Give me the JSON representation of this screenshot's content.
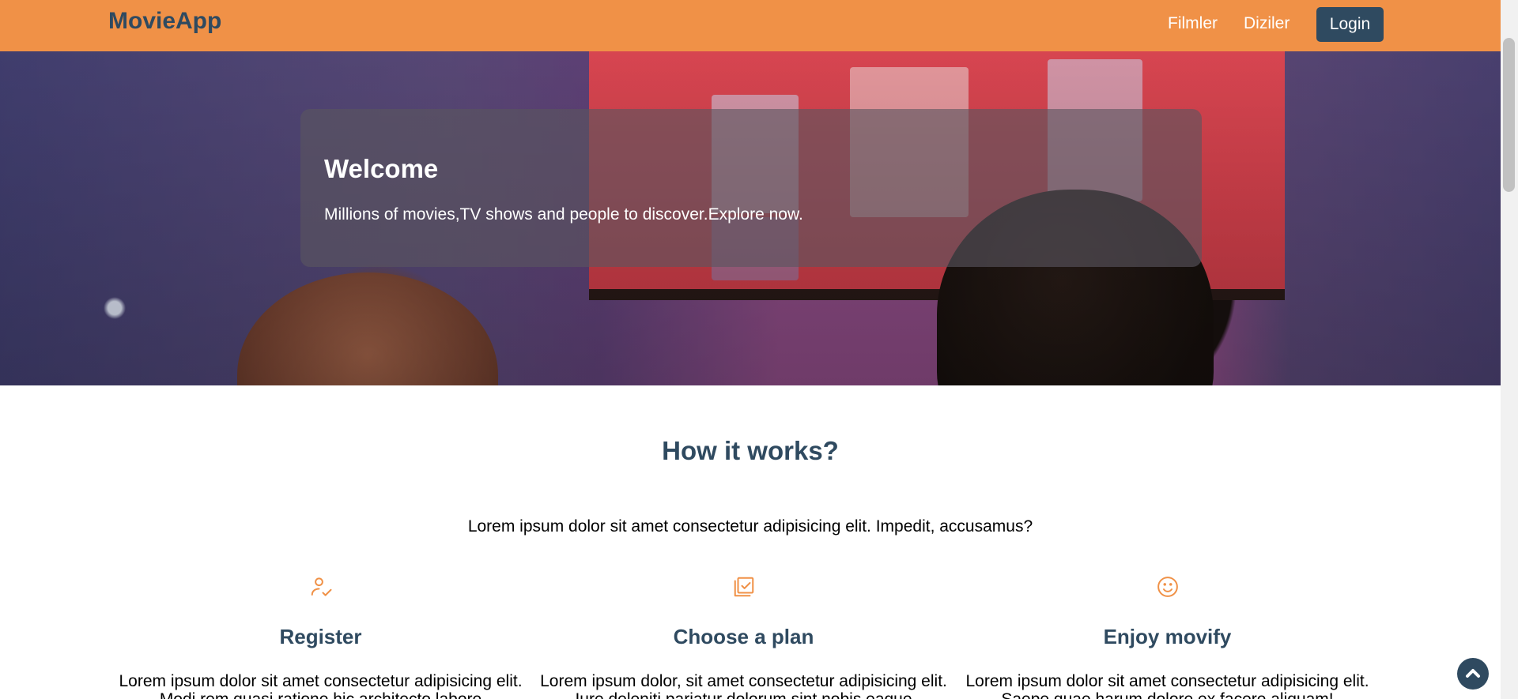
{
  "navbar": {
    "brand": "MovieApp",
    "links": [
      "Filmler",
      "Diziler"
    ],
    "login_label": "Login",
    "background": "#f09147",
    "brand_color": "#2f4a60"
  },
  "hero": {
    "title": "Welcome",
    "subtitle": "Millions of movies,TV shows and people to discover.Explore now."
  },
  "how": {
    "title": "How it works?",
    "subtitle": "Lorem ipsum dolor sit amet consectetur adipisicing elit. Impedit, accusamus?",
    "features": [
      {
        "icon": "user-check-icon",
        "title": "Register",
        "text": "Lorem ipsum dolor sit amet consectetur adipisicing elit. Modi rem quasi ratione hic architecto labore"
      },
      {
        "icon": "checklist-icon",
        "title": "Choose a plan",
        "text": "Lorem ipsum dolor, sit amet consectetur adipisicing elit. Iure deleniti pariatur dolorum sint nobis eaque"
      },
      {
        "icon": "smile-icon",
        "title": "Enjoy movify",
        "text": "Lorem ipsum dolor sit amet consectetur adipisicing elit. Saepe quae harum dolore ex facere aliquam!"
      }
    ],
    "accent": "#f09147"
  },
  "scroll_top": {
    "icon": "chevron-up-icon"
  }
}
